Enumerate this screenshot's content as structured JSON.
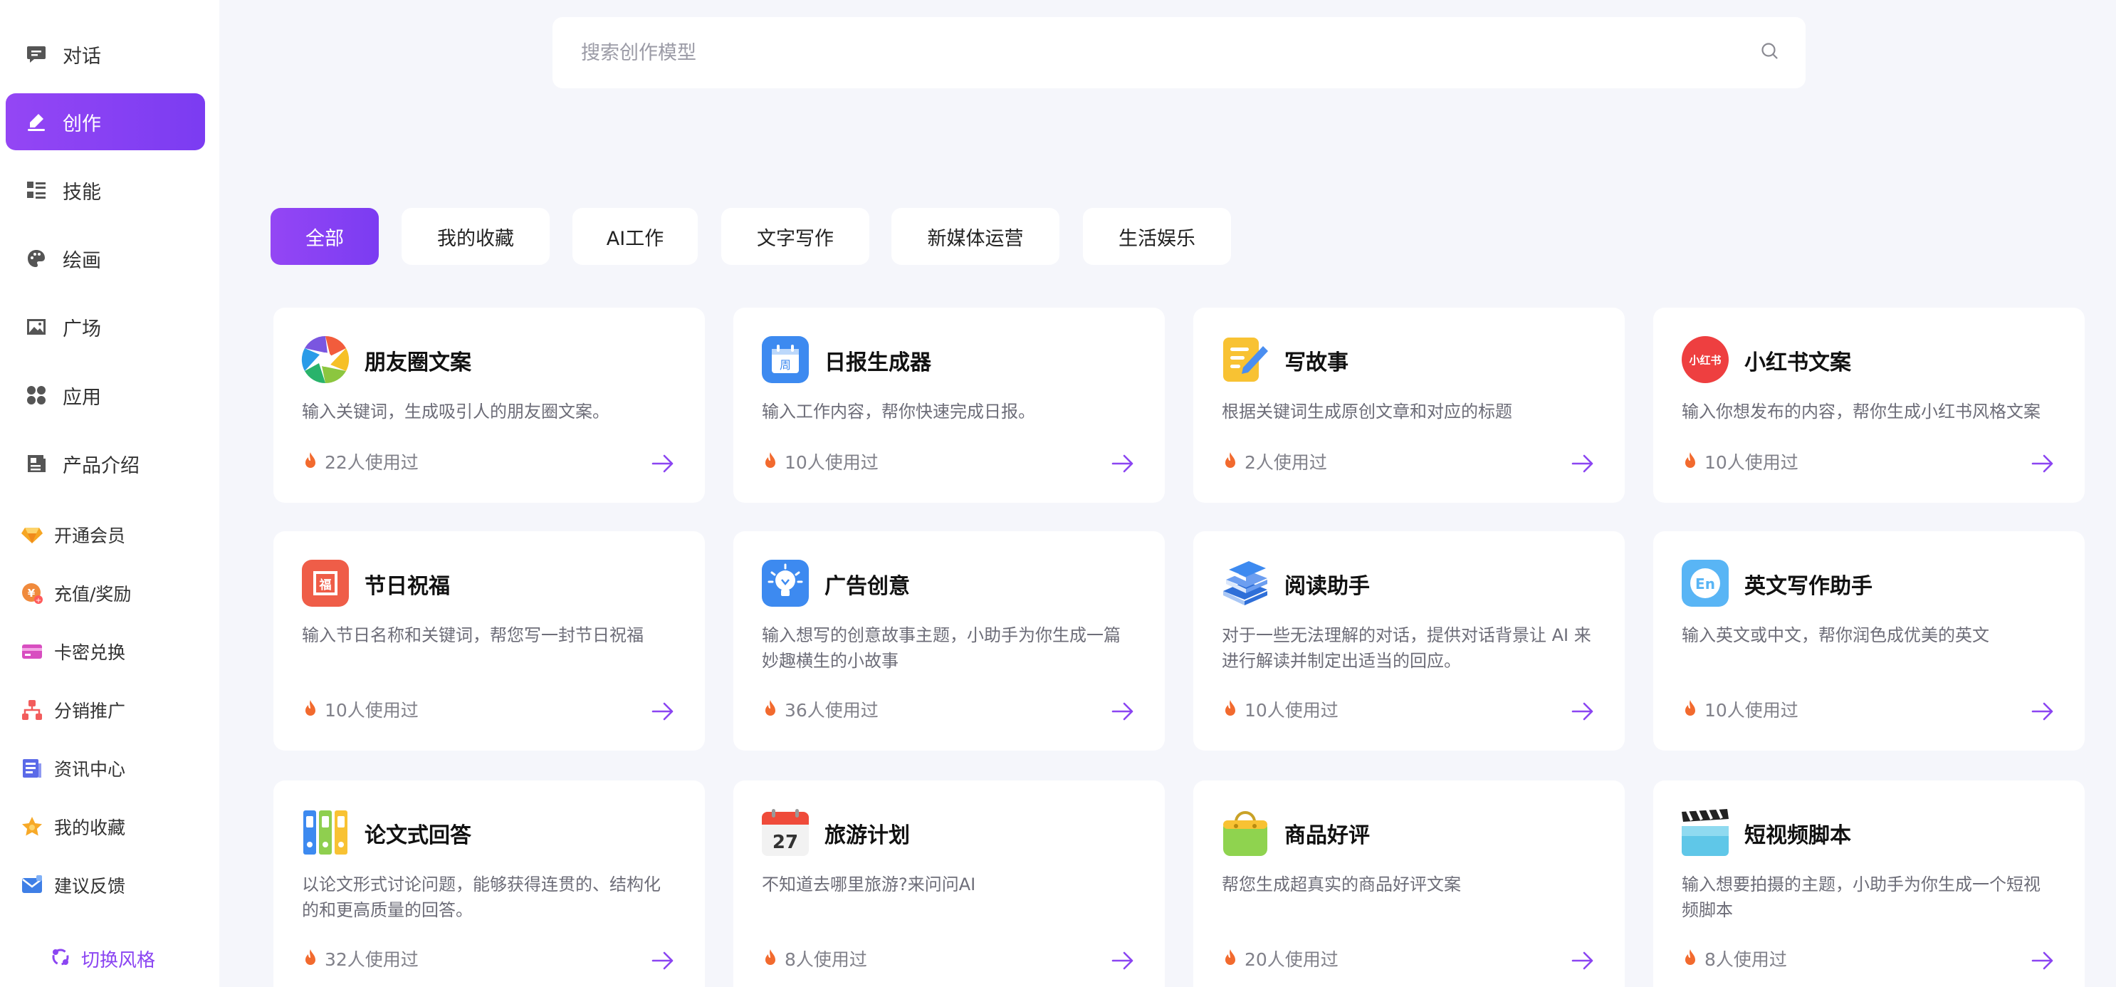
{
  "sidebar": {
    "nav": [
      {
        "label": "对话",
        "icon": "chat-icon"
      },
      {
        "label": "创作",
        "icon": "pen-icon"
      },
      {
        "label": "技能",
        "icon": "list-icon"
      },
      {
        "label": "绘画",
        "icon": "palette-icon"
      },
      {
        "label": "广场",
        "icon": "image-icon"
      },
      {
        "label": "应用",
        "icon": "apps-icon"
      },
      {
        "label": "产品介绍",
        "icon": "doc-icon"
      }
    ],
    "sub": [
      {
        "label": "开通会员",
        "icon": "diamond-icon"
      },
      {
        "label": "充值/奖励",
        "icon": "coin-icon"
      },
      {
        "label": "卡密兑换",
        "icon": "card-icon"
      },
      {
        "label": "分销推广",
        "icon": "org-icon"
      },
      {
        "label": "资讯中心",
        "icon": "news-icon"
      },
      {
        "label": "我的收藏",
        "icon": "star-icon"
      },
      {
        "label": "建议反馈",
        "icon": "mail-icon"
      }
    ],
    "theme_switch": "切换风格"
  },
  "search": {
    "placeholder": "搜索创作模型"
  },
  "tabs": [
    "全部",
    "我的收藏",
    "AI工作",
    "文字写作",
    "新媒体运营",
    "生活娱乐"
  ],
  "colors": {
    "accent": "#8b45f2",
    "background": "#f5f6fb",
    "fire": "#f26a2e"
  },
  "cards": [
    {
      "title": "朋友圈文案",
      "desc": "输入关键词，生成吸引人的朋友圈文案。",
      "usage": "22人使用过",
      "icon": "camera-aperture-icon"
    },
    {
      "title": "日报生成器",
      "desc": "输入工作内容，帮你快速完成日报。",
      "usage": "10人使用过",
      "icon": "calendar-week-icon",
      "icon_text": "周"
    },
    {
      "title": "写故事",
      "desc": "根据关键词生成原创文章和对应的标题",
      "usage": "2人使用过",
      "icon": "notepad-pencil-icon"
    },
    {
      "title": "小红书文案",
      "desc": "输入你想发布的内容，帮你生成小红书风格文案",
      "usage": "10人使用过",
      "icon": "xiaohongshu-icon",
      "icon_text": "小红书"
    },
    {
      "title": "节日祝福",
      "desc": "输入节日名称和关键词，帮您写一封节日祝福",
      "usage": "10人使用过",
      "icon": "fu-icon",
      "icon_text": "福"
    },
    {
      "title": "广告创意",
      "desc": "输入想写的创意故事主题，小助手为你生成一篇妙趣横生的小故事",
      "usage": "36人使用过",
      "icon": "lightbulb-icon"
    },
    {
      "title": "阅读助手",
      "desc": "对于一些无法理解的对话，提供对话背景让 AI 来进行解读并制定出适当的回应。",
      "usage": "10人使用过",
      "icon": "books-icon"
    },
    {
      "title": "英文写作助手",
      "desc": "输入英文或中文，帮你润色成优美的英文",
      "usage": "10人使用过",
      "icon": "english-icon",
      "icon_text": "En"
    },
    {
      "title": "论文式回答",
      "desc": "以论文形式讨论问题，能够获得连贯的、结构化的和更高质量的回答。",
      "usage": "32人使用过",
      "icon": "binders-icon"
    },
    {
      "title": "旅游计划",
      "desc": "不知道去哪里旅游?来问问AI",
      "usage": "8人使用过",
      "icon": "calendar-icon",
      "icon_text": "27"
    },
    {
      "title": "商品好评",
      "desc": "帮您生成超真实的商品好评文案",
      "usage": "20人使用过",
      "icon": "shopping-bag-icon"
    },
    {
      "title": "短视频脚本",
      "desc": "输入想要拍摄的主题，小助手为你生成一个短视频脚本",
      "usage": "8人使用过",
      "icon": "clapperboard-icon"
    }
  ]
}
